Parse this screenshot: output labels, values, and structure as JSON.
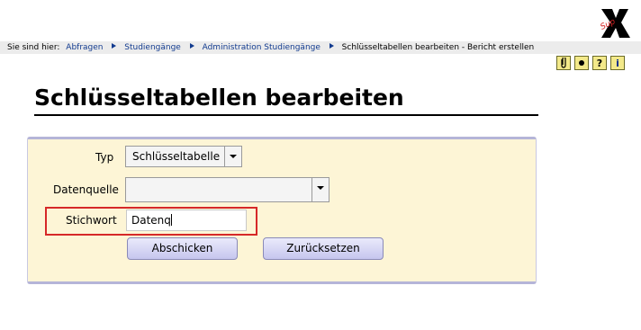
{
  "breadcrumb": {
    "prefix": "Sie sind hier:",
    "items": [
      "Abfragen",
      "Studiengänge",
      "Administration Studiengänge"
    ],
    "current": "Schlüsseltabellen bearbeiten - Bericht erstellen"
  },
  "toolbar": {
    "icons": [
      "clip-icon",
      "bullet-icon",
      "help-icon",
      "info-icon"
    ],
    "help_glyph": "?",
    "info_glyph": "i"
  },
  "page": {
    "title": "Schlüsseltabellen bearbeiten"
  },
  "form": {
    "typ_label": "Typ",
    "typ_value": "Schlüsseltabelle",
    "datenquelle_label": "Datenquelle",
    "datenquelle_value": "",
    "stichwort_label": "Stichwort",
    "stichwort_value": "Datenq",
    "submit_label": "Abschicken",
    "reset_label": "Zurücksetzen"
  },
  "colors": {
    "accent": "#123b8f",
    "panel": "#fdf5d6",
    "highlight": "#d62828"
  }
}
